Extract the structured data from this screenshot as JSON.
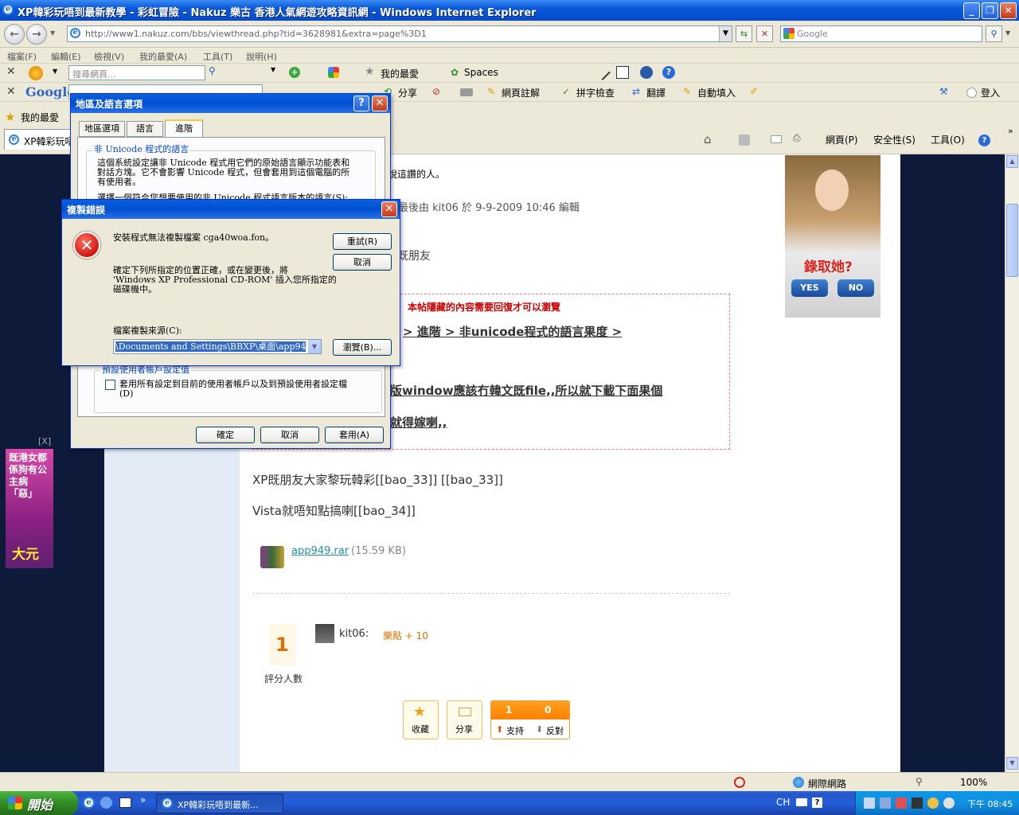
{
  "window": {
    "title": "XP韓彩玩唔到最新教學 - 彩虹冒險 - Nakuz 樂古 香港人氣網遊攻略資訊網 - Windows Internet Explorer"
  },
  "address": {
    "url": "http://www1.nakuz.com/bbs/viewthread.php?tid=3628981&extra=page%3D1",
    "search_placeholder": "Google"
  },
  "menu": [
    "檔案(F)",
    "編輯(E)",
    "檢視(V)",
    "我的最愛(A)",
    "工具(T)",
    "說明(H)"
  ],
  "toolbar1": {
    "search_placeholder": "搜尋網頁...",
    "favorites": "我的最愛",
    "spaces": "Spaces"
  },
  "toolbar2": {
    "google": "Google",
    "search": "搜尋",
    "share": "分享",
    "web_notes": "網頁註解",
    "spell_check": "拼字檢查",
    "translate": "翻譯",
    "autofill": "自動填入",
    "signin": "登入"
  },
  "toolbar3": {
    "favorites": "我的最愛",
    "tab_title": "XP韓彩玩唔"
  },
  "cmdbar": {
    "page": "網頁(P)",
    "safety": "安全性(S)",
    "tools": "工具(O)"
  },
  "content": {
    "line1": "說這讚的人。",
    "edited": "帖最後由 kit06 於 9-9-2009 10:46 編輯",
    "friend": "既朋友",
    "hidden_notice": "本帖隱藏的內容需要回復才可以瀏覽",
    "path": "> 進階 > 非unicode程式的語言果度 >",
    "bold1": "版window應該冇韓文既file,,所以就下載下面果個",
    "bold2": "就得嫁喇,,",
    "p1": "XP既朋友大家黎玩韓彩[[bao_33]] [[bao_33]]",
    "p2": "Vista就唔知點搞喇[[bao_34]]",
    "attach_name": "app949.rar",
    "attach_size": "(15.59 KB)",
    "rating_count": "1",
    "rating_label": "評分人數",
    "rater": "kit06:",
    "rater_points": "樂點 + 10",
    "btn_fav": "收藏",
    "btn_share": "分享",
    "support_count": "1",
    "oppose_count": "0",
    "support": "支持",
    "oppose": "反對",
    "ad_right_text": "錄取她?",
    "ad_yes": "YES",
    "ad_no": "NO",
    "ad_left_text": "既港女都係狗有公主病「惡」",
    "ad_left_name": "大元",
    "ad_close": "[X]"
  },
  "region_dialog": {
    "title": "地區及語言選項",
    "tabs": [
      "地區選項",
      "語言",
      "進階"
    ],
    "group1": "非 Unicode 程式的語言",
    "desc": [
      "這個系統設定讓非 Unicode 程式用它們的原始語言顯示功能表和",
      "對話方塊。它不會影響 Unicode 程式，但會套用到這個電腦的所",
      "有使用者。"
    ],
    "select_text": "選擇一個符合您想要使用的非 Unicode 程式語言版本的語言(S):",
    "group2": "預設使用者帳戶設定值",
    "checkbox": "套用所有設定到目前的使用者帳戶以及到預設使用者設定檔",
    "checkbox2": "(D)",
    "ok": "確定",
    "cancel": "取消",
    "apply": "套用(A)"
  },
  "copy_error": {
    "title": "複製錯誤",
    "message": "安裝程式無法複製檔案 cga40woa.fon。",
    "instruction": [
      "確定下列所指定的位置正確，或在變更後，將",
      "'Windows XP Professional CD-ROM' 插入您所指定的",
      "磁碟機中。"
    ],
    "source_label": "檔案複製來源(C):",
    "source_value": "\\Documents and Settings\\BBXP\\桌面\\app949\\i386",
    "retry": "重試(R)",
    "cancel": "取消",
    "browse": "瀏覽(B)..."
  },
  "status": {
    "zone": "網際網路",
    "zoom": "100%"
  },
  "taskbar": {
    "start": "開始",
    "task": "XP韓彩玩唔到最新...",
    "lang": "CH",
    "clock": "下午 08:45"
  },
  "colors": {
    "accent": "#0a5fe0",
    "page_bg": "#0e1a3a",
    "hidden_red": "#cc0000",
    "points_orange": "#e07000"
  }
}
